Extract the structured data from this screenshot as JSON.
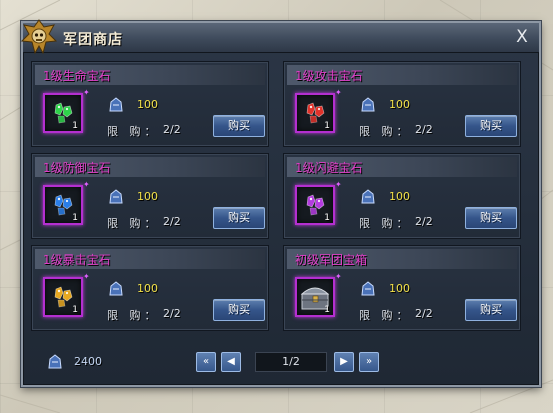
{
  "window": {
    "title": "军团商店",
    "close_label": "X"
  },
  "shop": {
    "limit_label": "限  购：",
    "buy_label": "购买",
    "items": [
      {
        "name": "1级生命宝石",
        "count": "1",
        "price": "100",
        "limit": "2/2",
        "gem_color": "#2ed34a",
        "icon": "green-gem-icon"
      },
      {
        "name": "1级攻击宝石",
        "count": "1",
        "price": "100",
        "limit": "2/2",
        "gem_color": "#e0322a",
        "icon": "red-gem-icon"
      },
      {
        "name": "1级防御宝石",
        "count": "1",
        "price": "100",
        "limit": "2/2",
        "gem_color": "#2a7ee8",
        "icon": "blue-gem-icon"
      },
      {
        "name": "1级闪避宝石",
        "count": "1",
        "price": "100",
        "limit": "2/2",
        "gem_color": "#b43be0",
        "icon": "purple-gem-icon"
      },
      {
        "name": "1级暴击宝石",
        "count": "1",
        "price": "100",
        "limit": "2/2",
        "gem_color": "#e8a820",
        "icon": "gold-gem-icon"
      },
      {
        "name": "初级军团宝箱",
        "count": "1",
        "price": "100",
        "limit": "2/2",
        "gem_color": "#8a93a0",
        "icon": "treasure-chest-icon"
      }
    ]
  },
  "footer": {
    "wallet_amount": "2400",
    "page": "1/2",
    "first_label": "«",
    "prev_label": "◀",
    "next_label": "▶",
    "last_label": "»"
  }
}
